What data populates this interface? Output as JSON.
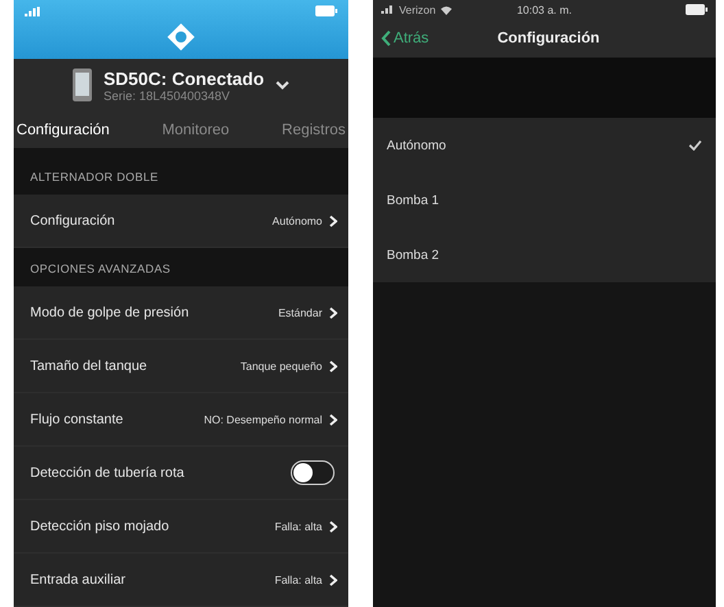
{
  "left_screen": {
    "device": {
      "title": "SD50C: Conectado",
      "serial": "Serie: 18L450400348V"
    },
    "tabs": [
      {
        "label": "Configuración",
        "selected": true
      },
      {
        "label": "Monitoreo",
        "selected": false
      },
      {
        "label": "Registros",
        "selected": false
      }
    ],
    "sections": [
      {
        "header": "ALTERNADOR DOBLE",
        "rows": [
          {
            "kind": "link",
            "label": "Configuración",
            "value": "Autónomo"
          }
        ]
      },
      {
        "header": "OPCIONES AVANZADAS",
        "rows": [
          {
            "kind": "link",
            "label": "Modo de golpe de presión",
            "value": "Estándar"
          },
          {
            "kind": "link",
            "label": "Tamaño del tanque",
            "value": "Tanque pequeño"
          },
          {
            "kind": "link",
            "label": "Flujo constante",
            "value": "NO: Desempeño normal"
          },
          {
            "kind": "toggle",
            "label": "Detección de tubería rota",
            "on": false
          },
          {
            "kind": "link",
            "label": "Detección piso mojado",
            "value": "Falla: alta"
          },
          {
            "kind": "link",
            "label": "Entrada auxiliar",
            "value": "Falla: alta"
          }
        ]
      }
    ]
  },
  "right_screen": {
    "status_bar": {
      "carrier": "Verizon",
      "time": "10:03 a. m."
    },
    "nav": {
      "back": "Atrás",
      "title": "Configuración"
    },
    "options": [
      {
        "label": "Autónomo",
        "selected": true
      },
      {
        "label": "Bomba 1",
        "selected": false
      },
      {
        "label": "Bomba 2",
        "selected": false
      }
    ]
  }
}
